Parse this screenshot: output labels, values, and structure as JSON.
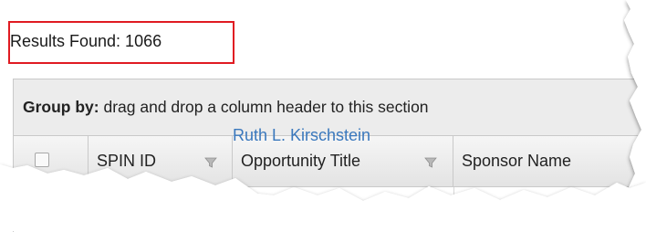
{
  "results": {
    "text": "Results Found: 1066"
  },
  "group_panel": {
    "label_bold": "Group by:",
    "text": " drag and drop a column header to this section"
  },
  "columns": [
    {
      "label": "",
      "type": "checkbox"
    },
    {
      "label": "SPIN ID",
      "filter_icon": "filter-funnel-icon"
    },
    {
      "label": "Opportunity Title",
      "filter_icon": "filter-funnel-icon"
    },
    {
      "label": "Sponsor Name"
    }
  ],
  "rows": [
    {
      "opportunity_title": "Ruth L. Kirschstein"
    }
  ],
  "colors": {
    "highlight_border": "#e01b22",
    "link": "#3a78bd",
    "header_bg": "#ececec"
  }
}
